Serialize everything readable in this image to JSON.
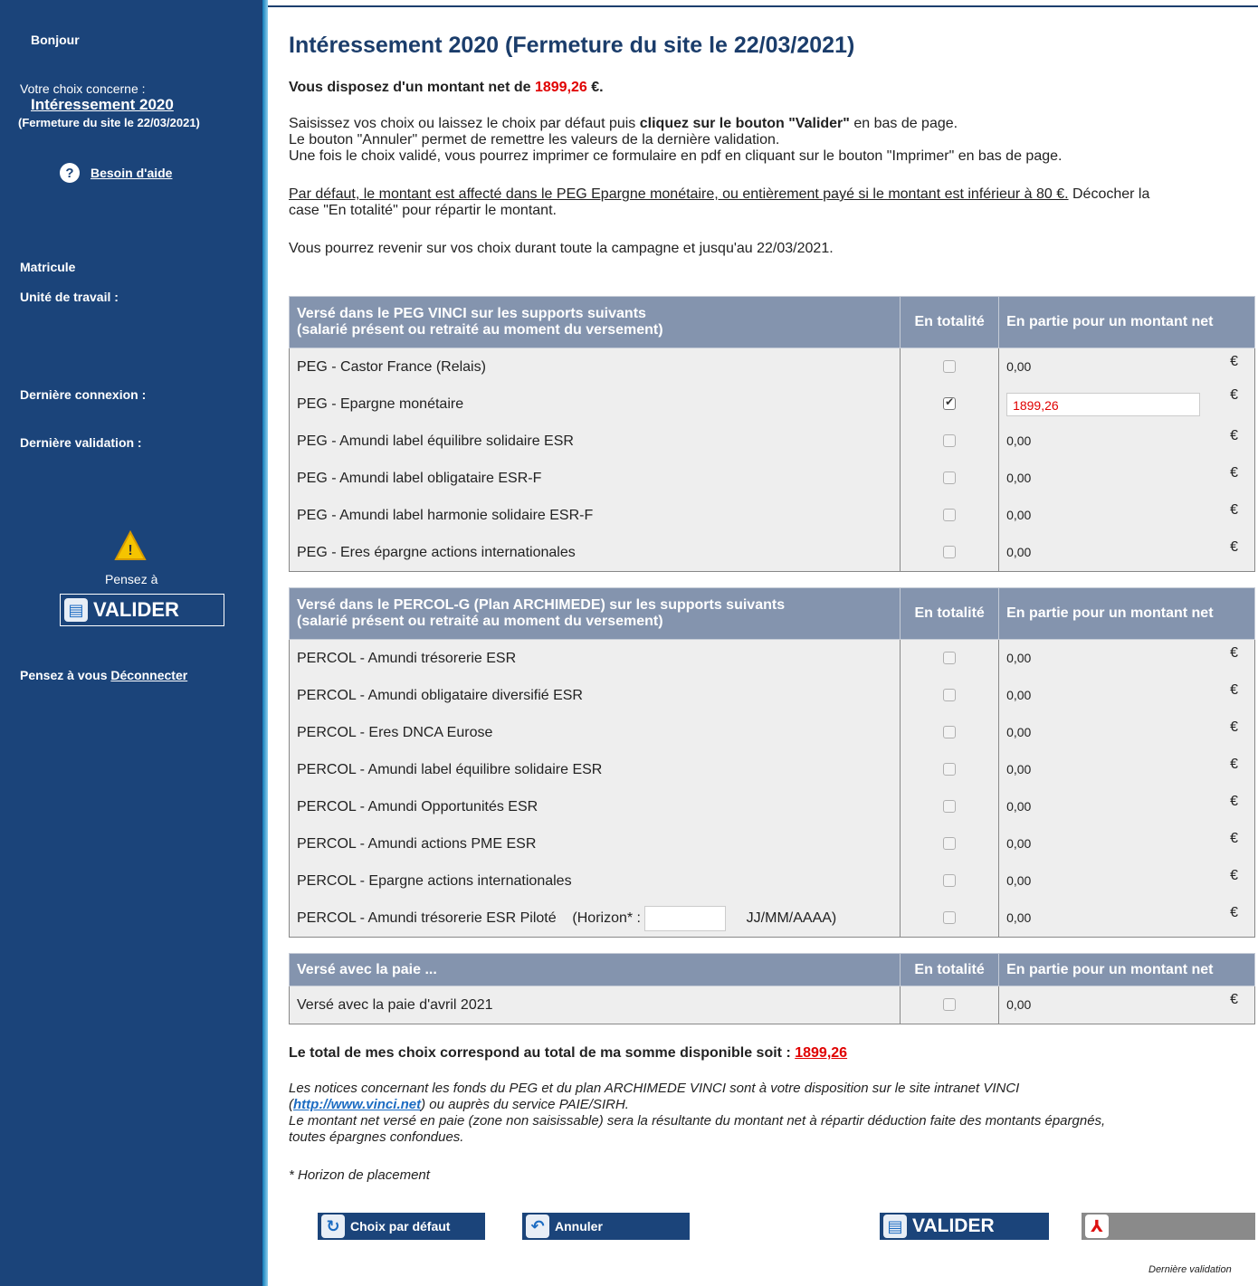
{
  "sidebar": {
    "greeting": "Bonjour",
    "choice_label": "Votre choix concerne :",
    "choice_title": "Intéressement 2020",
    "choice_subtitle": "(Fermeture du site le 22/03/2021)",
    "help_link": "Besoin d'aide",
    "matricule_label": "Matricule",
    "unit_label": "Unité de travail :",
    "last_connection_label": "Dernière connexion :",
    "last_validation_label": "Dernière validation :",
    "remind_label": "Pensez à",
    "validate_button": "VALIDER",
    "logout_prefix": "Pensez à vous",
    "logout_link": "Déconnecter"
  },
  "main": {
    "title": "Intéressement 2020 (Fermeture du site le 22/03/2021)",
    "amount_prefix": "Vous disposez d'un montant net de",
    "amount_value": "1899,26",
    "amount_suffix": "€.",
    "instr1_a": "Saisissez vos choix ou laissez le choix par défaut puis",
    "instr1_b": "cliquez sur le bouton \"Valider\"",
    "instr1_c": "en bas de page.",
    "instr2": "Le bouton \"Annuler\" permet de remettre les valeurs de la dernière validation.",
    "instr3": "Une fois le choix validé, vous pourrez imprimer ce formulaire en pdf en cliquant sur le bouton \"Imprimer\" en bas de page.",
    "default_underlined": "Par défaut, le montant est affecté dans le PEG Epargne monétaire, ou entièrement payé si le montant est inférieur à 80 €.",
    "default_rest_1": "Décocher la",
    "default_rest_2": "case \"En totalité\" pour répartir le montant.",
    "return_note": "Vous pourrez revenir sur vos choix durant toute la campagne et jusqu'au 22/03/2021."
  },
  "table_peg": {
    "header_line1": "Versé dans le PEG VINCI sur les supports suivants",
    "header_line2": "(salarié présent ou retraité au moment du versement)",
    "col_total": "En totalité",
    "col_partial": "En partie pour un montant net",
    "currency": "€",
    "rows": [
      {
        "label": "PEG - Castor France (Relais)",
        "checked": false,
        "amount": "0,00"
      },
      {
        "label": "PEG - Epargne monétaire",
        "checked": true,
        "amount": "1899,26"
      },
      {
        "label": "PEG - Amundi label équilibre solidaire ESR",
        "checked": false,
        "amount": "0,00"
      },
      {
        "label": "PEG - Amundi label obligataire ESR-F",
        "checked": false,
        "amount": "0,00"
      },
      {
        "label": "PEG - Amundi label harmonie solidaire ESR-F",
        "checked": false,
        "amount": "0,00"
      },
      {
        "label": "PEG - Eres épargne actions internationales",
        "checked": false,
        "amount": "0,00"
      }
    ]
  },
  "table_percol": {
    "header_line1": "Versé dans le PERCOL-G (Plan ARCHIMEDE) sur les supports suivants",
    "header_line2": "(salarié présent ou retraité au moment du versement)",
    "col_total": "En totalité",
    "col_partial": "En partie pour un montant net",
    "currency": "€",
    "rows": [
      {
        "label": "PERCOL - Amundi trésorerie ESR",
        "checked": false,
        "amount": "0,00"
      },
      {
        "label": "PERCOL - Amundi obligataire diversifié ESR",
        "checked": false,
        "amount": "0,00"
      },
      {
        "label": "PERCOL - Eres DNCA Eurose",
        "checked": false,
        "amount": "0,00"
      },
      {
        "label": "PERCOL - Amundi label équilibre solidaire ESR",
        "checked": false,
        "amount": "0,00"
      },
      {
        "label": "PERCOL - Amundi Opportunités ESR",
        "checked": false,
        "amount": "0,00"
      },
      {
        "label": "PERCOL - Amundi actions PME ESR",
        "checked": false,
        "amount": "0,00"
      },
      {
        "label": "PERCOL - Epargne actions internationales",
        "checked": false,
        "amount": "0,00"
      }
    ],
    "pilot_row": {
      "label": "PERCOL - Amundi trésorerie ESR Piloté",
      "horizon_label": "(Horizon* :",
      "horizon_value": "",
      "date_format": "JJ/MM/AAAA)",
      "amount": "0,00"
    }
  },
  "table_pay": {
    "header": "Versé avec la paie ...",
    "col_total": "En totalité",
    "col_partial": "En partie pour un montant net",
    "currency": "€",
    "rows": [
      {
        "label": "Versé avec la paie d'avril 2021",
        "checked": false,
        "amount": "0,00"
      }
    ]
  },
  "footer": {
    "total_text": "Le total de mes choix correspond au total de ma somme disponible soit :",
    "total_value": "1899,26",
    "notice1": "Les notices concernant les fonds du PEG et du plan ARCHIMEDE VINCI sont à votre disposition sur le site intranet VINCI",
    "notice_link": "http://www.vinci.net",
    "notice2": "ou auprès du service PAIE/SIRH.",
    "notice3": "Le montant net versé en paie (zone non saisissable) sera la résultante du montant net à répartir déduction faite des montants épargnés,",
    "notice4": "toutes épargnes confondues.",
    "horizon_note": "* Horizon de placement",
    "btn_default": "Choix par défaut",
    "btn_cancel": "Annuler",
    "btn_validate": "VALIDER",
    "last_validation": "Dernière validation"
  },
  "colors": {
    "sidebar": "#1b447a",
    "header": "#8494ae",
    "accent": "#e00000"
  }
}
